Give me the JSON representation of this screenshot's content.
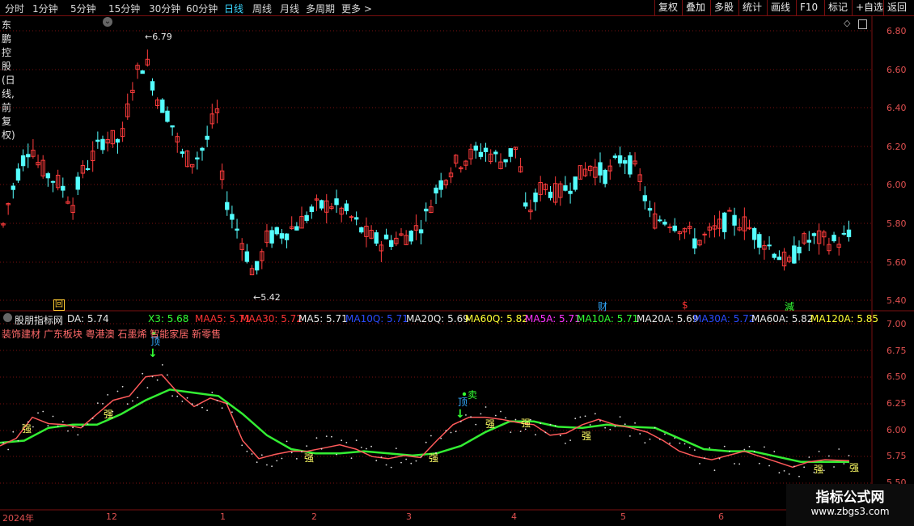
{
  "toolbar": {
    "periods": [
      "分时",
      "1分钟",
      "5分钟",
      "15分钟",
      "30分钟",
      "60分钟",
      "日线",
      "周线",
      "月线",
      "多周期",
      "更多 >"
    ],
    "active": "日线",
    "right": [
      "复权",
      "叠加",
      "多股",
      "统计",
      "画线",
      "F10",
      "标记",
      "+自选",
      "返回"
    ]
  },
  "header": {
    "title": "东鹏控股(日线,前复权)",
    "chevron": "⌄"
  },
  "main_axis": [
    "6.80",
    "6.60",
    "6.40",
    "6.20",
    "6.00",
    "5.80",
    "5.60",
    "5.40"
  ],
  "annotations": {
    "high": "6.79",
    "low": "5.42"
  },
  "event_markers": [
    {
      "label": "回",
      "color": "#ffcc33"
    },
    {
      "label": "财",
      "color": "#33aaff"
    },
    {
      "label": "$",
      "color": "#ff3333"
    },
    {
      "label": "減",
      "color": "#33ff33"
    }
  ],
  "indicator": {
    "name": "股朋指标网",
    "values": [
      {
        "text": "DA: 5.74",
        "color": "#e6e6e6"
      },
      {
        "text": "X3: 5.68",
        "color": "#33ff33"
      },
      {
        "text": "MAA5: 5.71",
        "color": "#ff3333"
      },
      {
        "text": "MAA30: 5.72",
        "color": "#ff3333"
      },
      {
        "text": "MA5: 5.71",
        "color": "#e6e6e6"
      },
      {
        "text": "MA10Q: 5.71",
        "color": "#2b4bff"
      },
      {
        "text": "MA20Q: 5.69",
        "color": "#e6e6e6"
      },
      {
        "text": "MA60Q: 5.82",
        "color": "#ffff33"
      },
      {
        "text": "MA5A: 5.71",
        "color": "#ff33ff"
      },
      {
        "text": "MA10A: 5.71",
        "color": "#33ff33"
      },
      {
        "text": "MA20A: 5.69",
        "color": "#e6e6e6"
      },
      {
        "text": "MA30A: 5.72",
        "color": "#2b4bff"
      },
      {
        "text": "MA60A: 5.82",
        "color": "#e6e6e6"
      },
      {
        "text": "MA120A: 5.85",
        "color": "#ffff33"
      }
    ],
    "tags": "装饰建材 广东板块 粤港澳 石墨烯 智能家居 新零售",
    "axis": [
      "7.00",
      "6.75",
      "6.50",
      "6.25",
      "6.00",
      "5.75",
      "5.50"
    ],
    "signal_top": "顶",
    "signal_sell": "卖",
    "strong": "强"
  },
  "time_axis": [
    "2024年",
    "12",
    "1",
    "2",
    "3",
    "4",
    "5",
    "6"
  ],
  "watermark": {
    "line1": "指标公式网",
    "line2": "www.zbgs3.com"
  },
  "colors": {
    "up": "#ff3c3c",
    "down": "#54ffff",
    "grid": "#7a0f0f",
    "axis_text": "#e05050"
  }
}
